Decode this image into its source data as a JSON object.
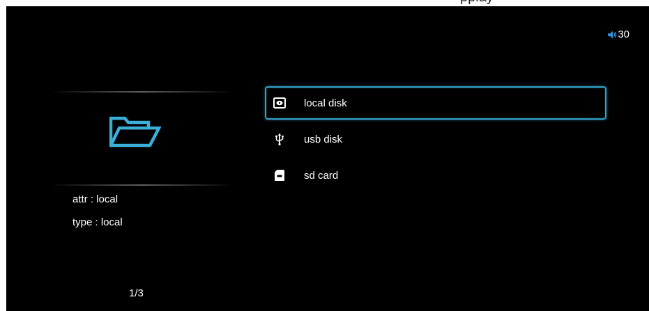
{
  "top_caption": "pplay",
  "volume": {
    "value": "30",
    "icon": "speaker-icon"
  },
  "current_folder": {
    "icon": "folder-open-icon",
    "attr_line": "attr : local",
    "type_line": "type : local"
  },
  "pagination": "1/3",
  "menu": {
    "selected_index": 0,
    "accent_color": "#34a3c9",
    "items": [
      {
        "label": "local disk",
        "icon": "hard-disk-icon"
      },
      {
        "label": "usb disk",
        "icon": "usb-icon"
      },
      {
        "label": "sd card",
        "icon": "sd-card-icon"
      }
    ]
  }
}
